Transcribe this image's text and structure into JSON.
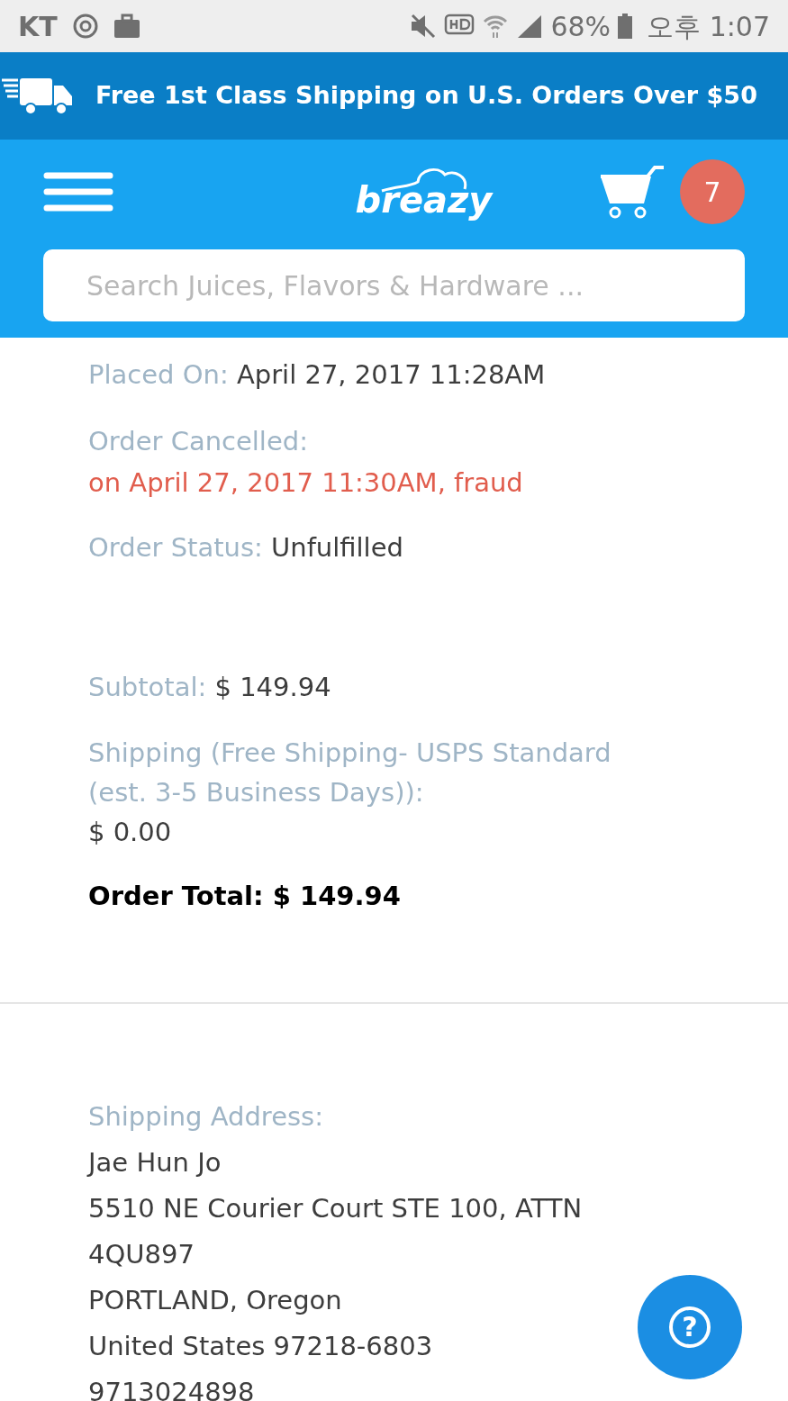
{
  "status_bar": {
    "carrier": "KT",
    "battery": "68%",
    "time": "오후 1:07"
  },
  "banner": {
    "text": "Free 1st Class Shipping on U.S. Orders Over $50"
  },
  "header": {
    "logo": "breazy",
    "cart_count": "7",
    "search": {
      "placeholder": "Search Juices, Flavors & Hardware ..."
    }
  },
  "order_details": [
    {
      "kind": "inline",
      "label": "Placed On:",
      "value": "April 27, 2017 11:28AM"
    },
    {
      "kind": "alert",
      "label": "Order Cancelled:",
      "value": "on April 27, 2017 11:30AM, fraud"
    },
    {
      "kind": "inline",
      "label": "Order Status:",
      "value": "Unfulfilled"
    }
  ],
  "totals": [
    {
      "kind": "inline",
      "label": "Subtotal:",
      "value": "$ 149.94"
    },
    {
      "kind": "block",
      "label": "Shipping (Free Shipping- USPS Standard (est. 3-5 Business Days)):",
      "value": "$ 0.00"
    }
  ],
  "order_total": {
    "label": "Order Total:",
    "value": "$ 149.94"
  },
  "shipping_address": {
    "label": "Shipping Address:",
    "lines": [
      "Jae Hun Jo",
      "5510 NE Courier Court STE 100, ATTN",
      "4QU897",
      "PORTLAND, Oregon",
      "United States 97218-6803",
      "9713024898"
    ]
  },
  "help_button": {
    "label": "?"
  }
}
